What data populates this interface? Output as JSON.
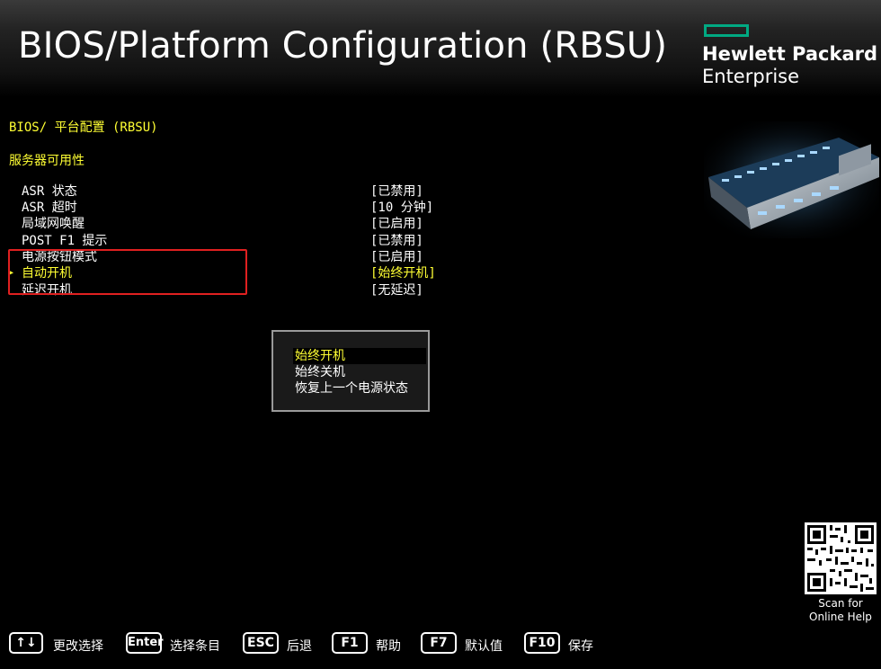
{
  "header": {
    "title": "BIOS/Platform Configuration (RBSU)",
    "brand_line1": "Hewlett Packard",
    "brand_line2": "Enterprise",
    "brand_color": "#01a982"
  },
  "breadcrumb": "BIOS/ 平台配置 (RBSU)",
  "section_title": "服务器可用性",
  "settings": [
    {
      "label": "ASR 状态",
      "value": "[已禁用]"
    },
    {
      "label": "ASR 超时",
      "value": "[10 分钟]"
    },
    {
      "label": "局域网唤醒",
      "value": "[已启用]"
    },
    {
      "label": "POST F1 提示",
      "value": "[已禁用]"
    },
    {
      "label": "电源按钮模式",
      "value": "[已启用]"
    },
    {
      "label": "自动开机",
      "value": "[始终开机]"
    },
    {
      "label": "延迟开机",
      "value": "[无延迟]"
    }
  ],
  "selected_setting": "自动开机",
  "popup": {
    "options": [
      "始终开机",
      "始终关机",
      "恢复上一个电源状态"
    ],
    "selected": "始终开机"
  },
  "qr": {
    "caption_line1": "Scan for",
    "caption_line2": "Online Help"
  },
  "footer": {
    "keys": [
      {
        "key": "↑↓",
        "label": "更改选择"
      },
      {
        "key": "Enter",
        "label": "选择条目"
      },
      {
        "key": "ESC",
        "label": "后退"
      },
      {
        "key": "F1",
        "label": "帮助"
      },
      {
        "key": "F7",
        "label": "默认值"
      },
      {
        "key": "F10",
        "label": "保存"
      }
    ]
  },
  "colors": {
    "highlight": "#ffff33",
    "annotation_box": "#e02020"
  }
}
